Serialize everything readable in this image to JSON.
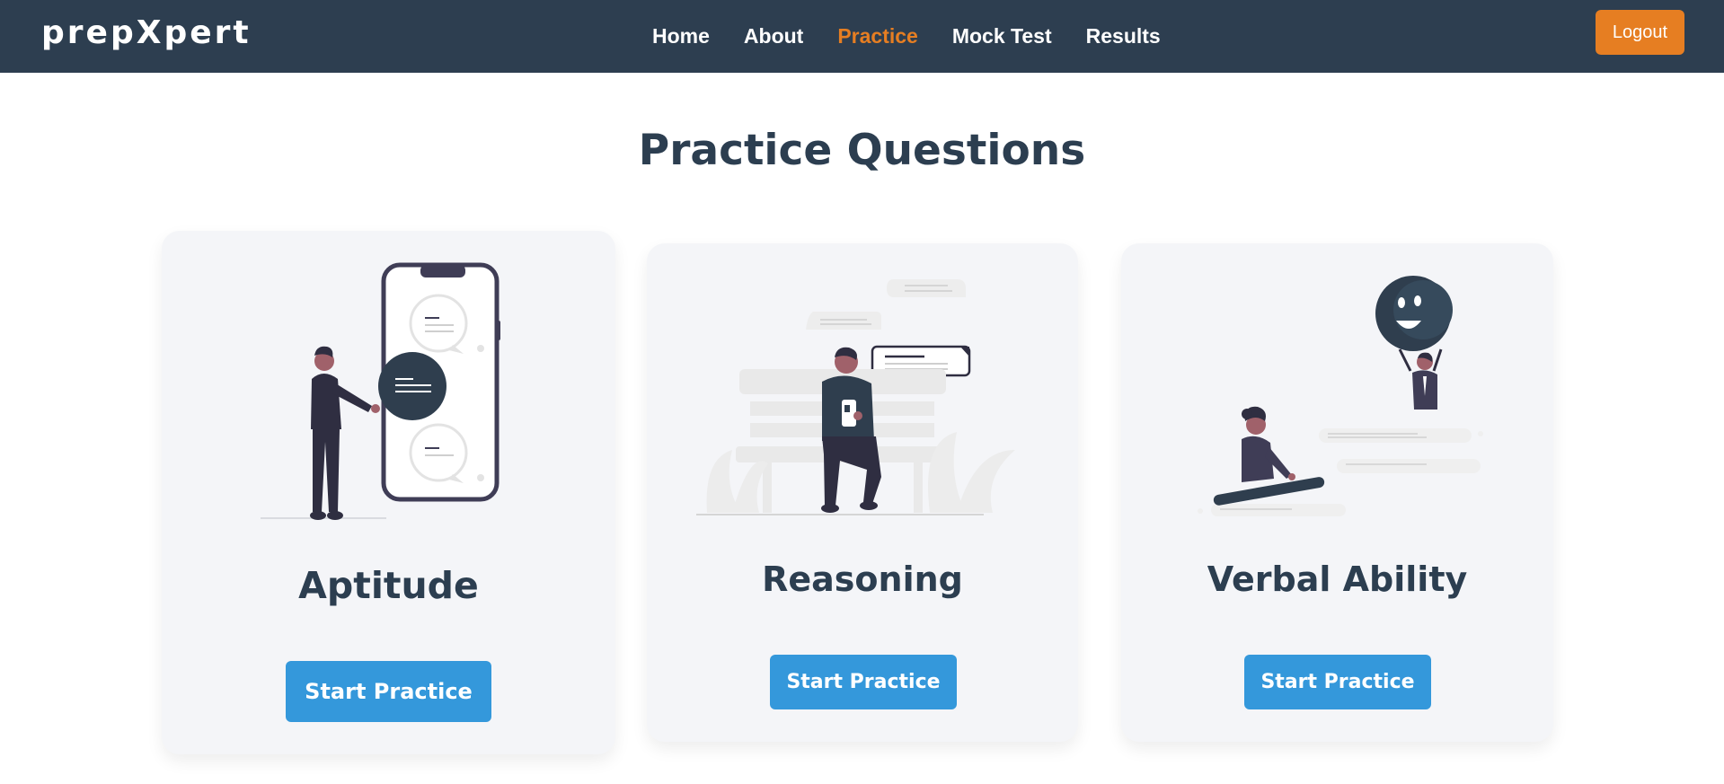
{
  "navbar": {
    "brand": "prepXpert",
    "links": [
      {
        "label": "Home",
        "active": false
      },
      {
        "label": "About",
        "active": false
      },
      {
        "label": "Practice",
        "active": true
      },
      {
        "label": "Mock Test",
        "active": false
      },
      {
        "label": "Results",
        "active": false
      }
    ],
    "logout_label": "Logout"
  },
  "main": {
    "title": "Practice Questions",
    "cards": [
      {
        "title": "Aptitude",
        "button_label": "Start Practice",
        "illustration": "person-with-phone-chat-illustration"
      },
      {
        "title": "Reasoning",
        "button_label": "Start Practice",
        "illustration": "person-on-bench-texting-illustration"
      },
      {
        "title": "Verbal Ability",
        "button_label": "Start Practice",
        "illustration": "people-with-smiley-balloon-illustration"
      }
    ]
  },
  "colors": {
    "navbar_bg": "#2d3e50",
    "accent_orange": "#e67e22",
    "button_blue": "#3498db",
    "text_dark": "#2c3e50",
    "card_bg": "#f4f5f8"
  }
}
